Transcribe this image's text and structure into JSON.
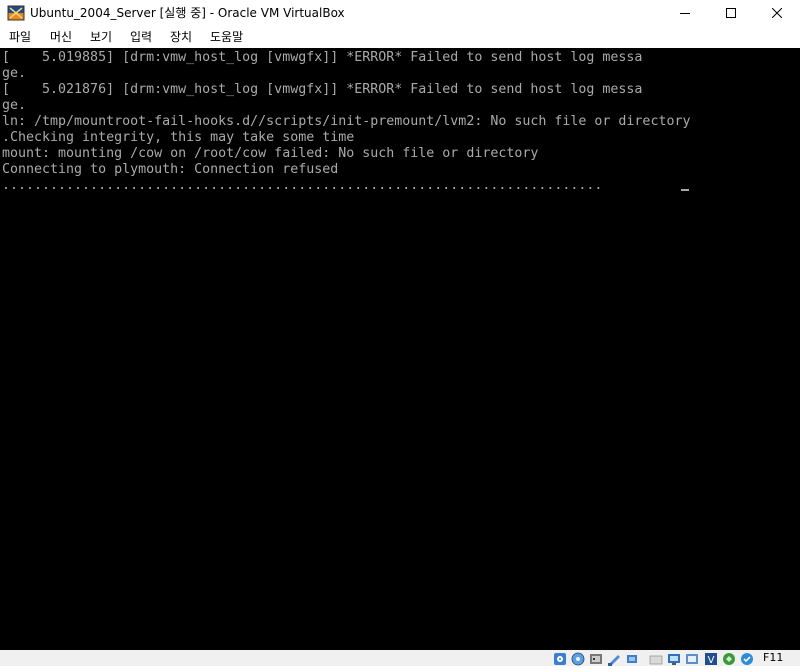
{
  "window": {
    "title": "Ubuntu_2004_Server [실행 중] - Oracle VM VirtualBox"
  },
  "menu": {
    "items": [
      {
        "label": "파일"
      },
      {
        "label": "머신"
      },
      {
        "label": "보기"
      },
      {
        "label": "입력"
      },
      {
        "label": "장치"
      },
      {
        "label": "도움말"
      }
    ]
  },
  "console": {
    "lines": [
      "[    5.019885] [drm:vmw_host_log [vmwgfx]] *ERROR* Failed to send host log messa",
      "ge.",
      "[    5.021876] [drm:vmw_host_log [vmwgfx]] *ERROR* Failed to send host log messa",
      "ge.",
      "ln: /tmp/mountroot-fail-hooks.d//scripts/init-premount/lvm2: No such file or directory",
      ".Checking integrity, this may take some time",
      "mount: mounting /cow on /root/cow failed: No such file or directory",
      "Connecting to plymouth: Connection refused",
      "..........................................................................."
    ]
  },
  "statusbar": {
    "host_key": "F11",
    "icons": [
      "hard-disk-icon",
      "optical-drive-icon",
      "audio-icon",
      "network-icon",
      "usb-icon",
      "shared-folders-icon",
      "display-icon",
      "video-capture-icon",
      "virtualization-icon",
      "mouse-integration-icon",
      "keyboard-icon"
    ]
  }
}
